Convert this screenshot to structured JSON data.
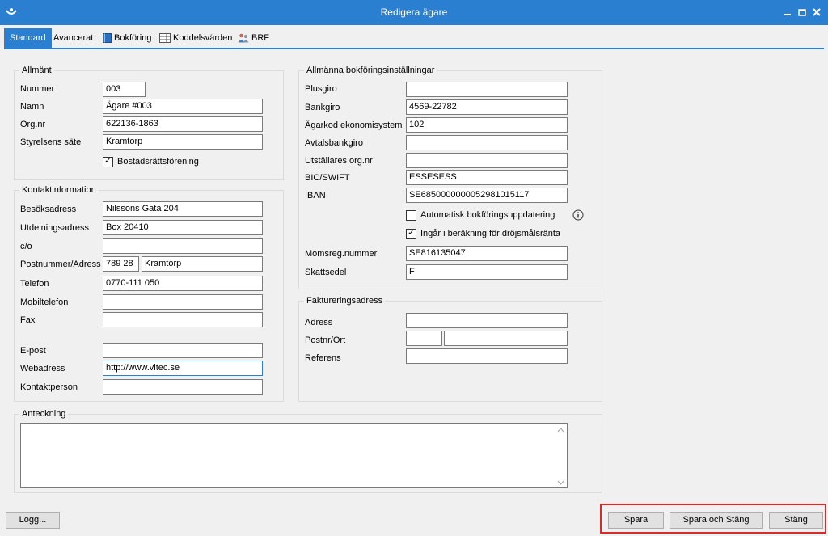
{
  "window": {
    "title": "Redigera ägare"
  },
  "tabs": [
    {
      "label": "Standard",
      "icon": "none"
    },
    {
      "label": "Avancerat",
      "icon": "none"
    },
    {
      "label": "Bokföring",
      "icon": "book-icon"
    },
    {
      "label": "Koddelsvärden",
      "icon": "table-icon"
    },
    {
      "label": "BRF",
      "icon": "users-icon"
    }
  ],
  "allmant": {
    "legend": "Allmänt",
    "nummer_label": "Nummer",
    "nummer": "003",
    "namn_label": "Namn",
    "namn": "Ägare #003",
    "orgnr_label": "Org.nr",
    "orgnr": "622136-1863",
    "styrelsens_sate_label": "Styrelsens säte",
    "styrelsens_sate": "Kramtorp",
    "bostadsratt_label": "Bostadsrättsförening",
    "bostadsratt_checked": true
  },
  "kontakt": {
    "legend": "Kontaktinformation",
    "besok_label": "Besöksadress",
    "besok": "Nilssons Gata 204",
    "utdel_label": "Utdelningsadress",
    "utdel": "Box 20410",
    "co_label": "c/o",
    "co": "",
    "postnr_label": "Postnummer/Adress",
    "postnr": "789 28",
    "ort": "Kramtorp",
    "telefon_label": "Telefon",
    "telefon": "0770-111 050",
    "mobil_label": "Mobiltelefon",
    "mobil": "",
    "fax_label": "Fax",
    "fax": "",
    "epost_label": "E-post",
    "epost": "",
    "webb_label": "Webadress",
    "webb": "http://www.vitec.se",
    "kontaktperson_label": "Kontaktperson",
    "kontaktperson": ""
  },
  "bokforing": {
    "legend": "Allmänna bokföringsinställningar",
    "plusgiro_label": "Plusgiro",
    "plusgiro": "",
    "bankgiro_label": "Bankgiro",
    "bankgiro": "4569-22782",
    "agarkod_label": "Ägarkod ekonomisystem",
    "agarkod": "102",
    "avtalsbankgiro_label": "Avtalsbankgiro",
    "avtalsbankgiro": "",
    "utstallare_label": "Utställares org.nr",
    "utstallare": "",
    "bic_label": "BIC/SWIFT",
    "bic": "ESSESESS",
    "iban_label": "IBAN",
    "iban": "SE6850000000052981015117",
    "auto_label": "Automatisk bokföringsuppdatering",
    "auto_checked": false,
    "drojsmal_label": "Ingår i beräkning för dröjsmålsränta",
    "drojsmal_checked": true,
    "moms_label": "Momsreg.nummer",
    "moms": "SE816135047",
    "skattsedel_label": "Skattsedel",
    "skattsedel": "F"
  },
  "faktura": {
    "legend": "Faktureringsadress",
    "adress_label": "Adress",
    "adress": "",
    "postnr_label": "Postnr/Ort",
    "postnr": "",
    "ort": "",
    "referens_label": "Referens",
    "referens": ""
  },
  "anteckning": {
    "legend": "Anteckning",
    "text": ""
  },
  "buttons": {
    "logg": "Logg...",
    "spara": "Spara",
    "spara_stang": "Spara och Stäng",
    "stang": "Stäng"
  },
  "colors": {
    "accent": "#2b7fd1",
    "highlight": "#d9292a",
    "background": "#f0f0f0"
  }
}
